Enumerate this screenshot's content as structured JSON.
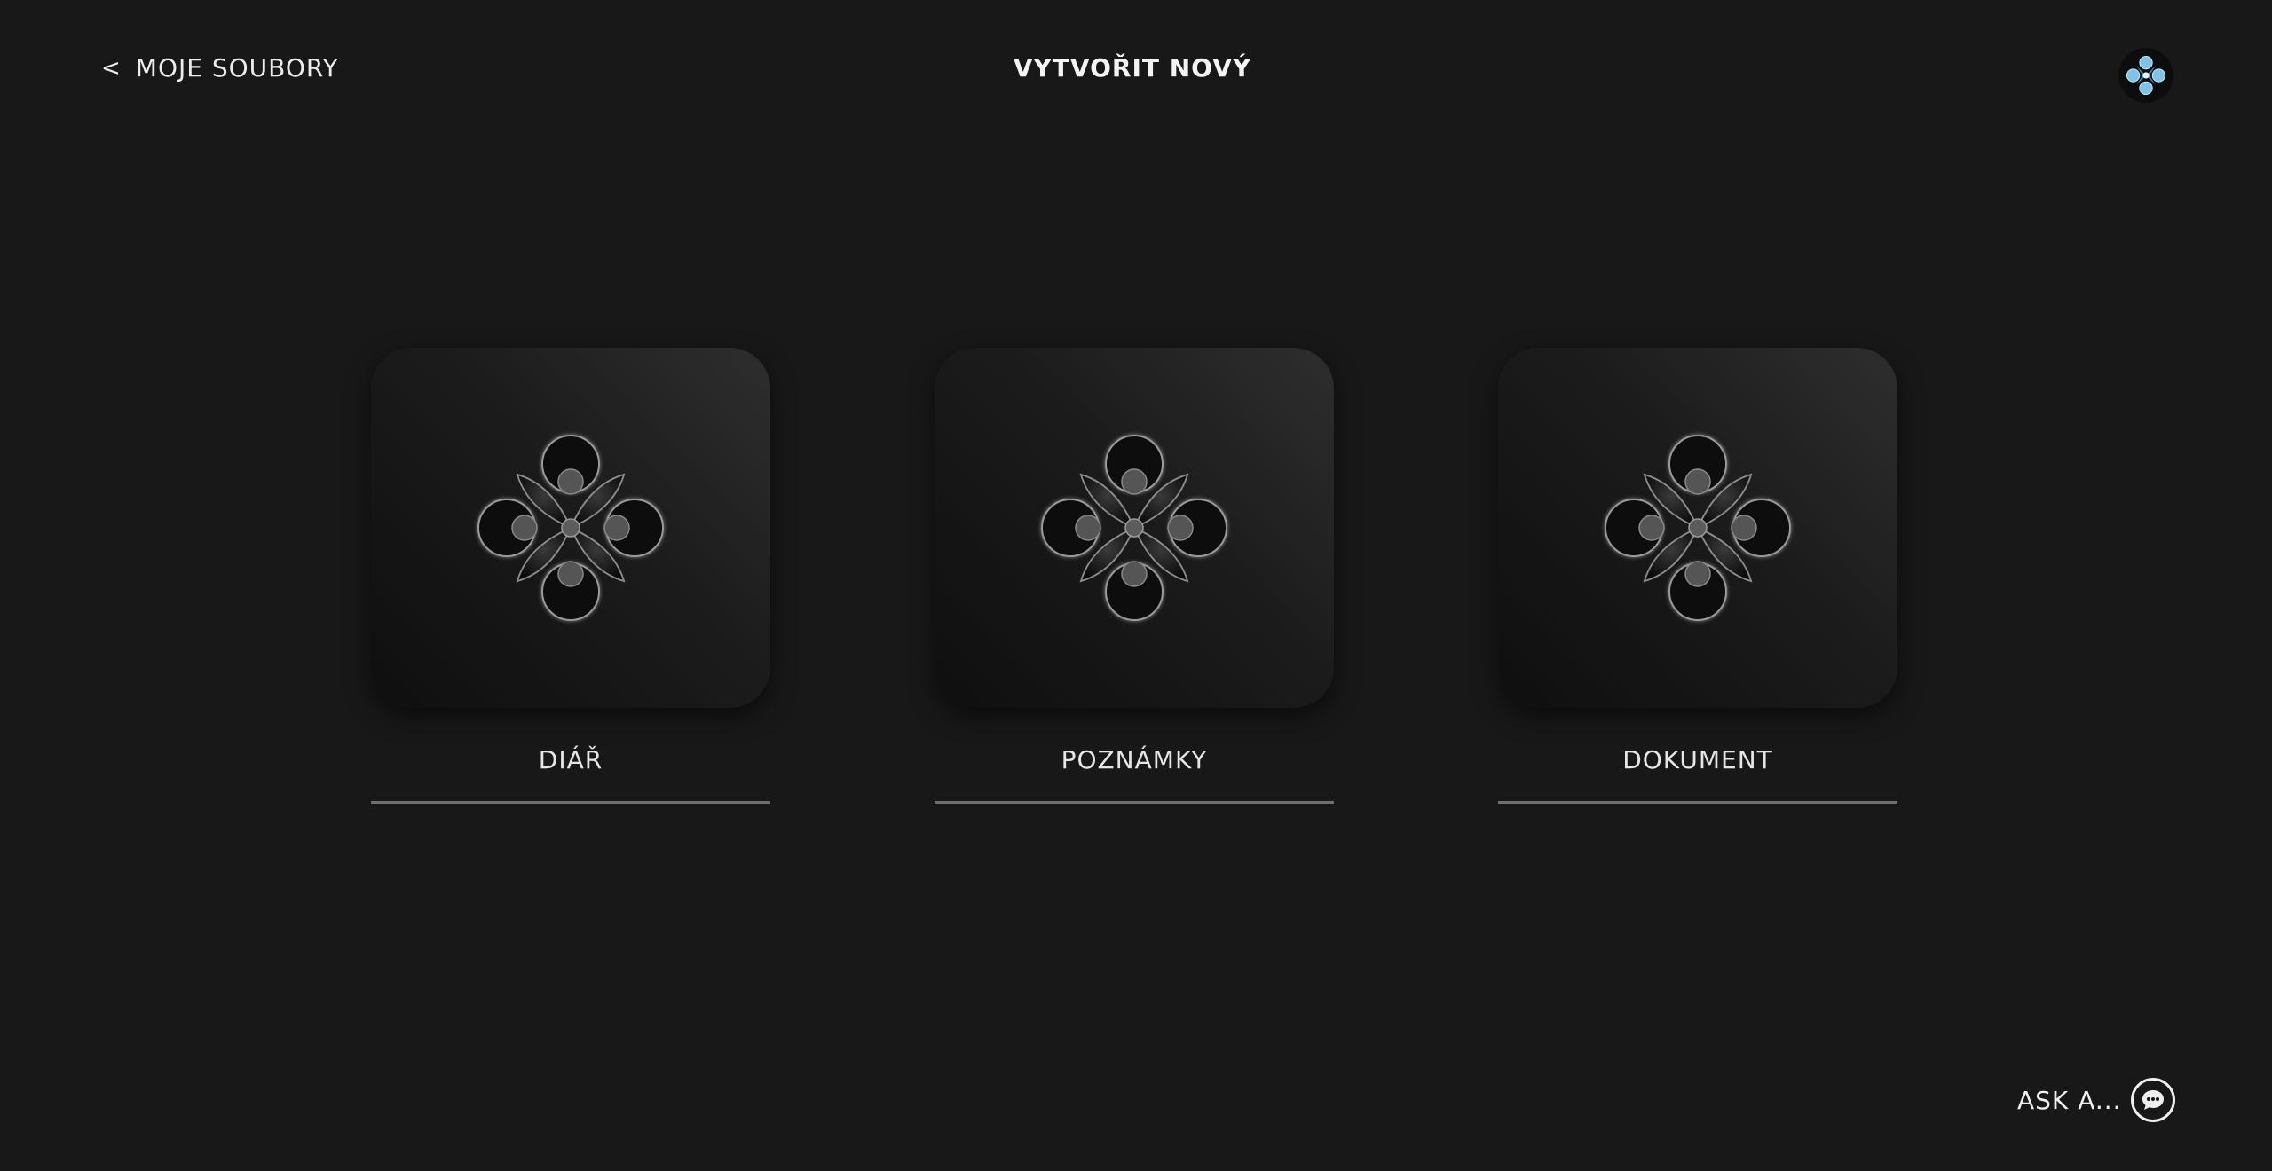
{
  "header": {
    "back_label": "MOJE SOUBORY",
    "back_chevron": "<",
    "title": "VYTVOŘIT NOVÝ",
    "logo_icon": "flower-logo-icon"
  },
  "templates": [
    {
      "label": "DIÁŘ",
      "icon": "flower-icon"
    },
    {
      "label": "POZNÁMKY",
      "icon": "flower-icon"
    },
    {
      "label": "DOKUMENT",
      "icon": "flower-icon"
    }
  ],
  "assistant": {
    "label": "ASK A...",
    "icon": "chat-bubble-icon"
  },
  "colors": {
    "background": "#181818",
    "accent_logo": "#7fc4e8",
    "divider": "#6e6e6e"
  }
}
